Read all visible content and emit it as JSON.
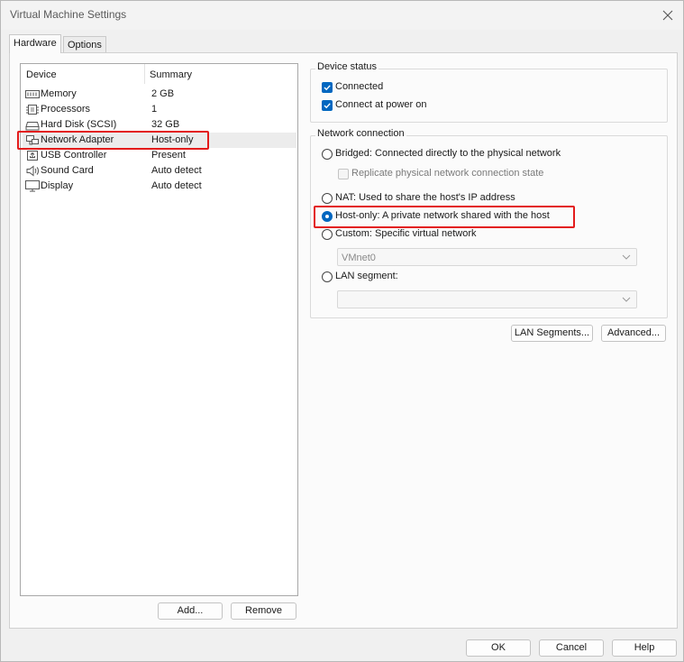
{
  "window": {
    "title": "Virtual Machine Settings"
  },
  "tabs": [
    {
      "label": "Hardware",
      "active": true
    },
    {
      "label": "Options",
      "active": false
    }
  ],
  "device_list": {
    "headers": {
      "device": "Device",
      "summary": "Summary"
    },
    "rows": [
      {
        "name": "Memory",
        "summary": "2 GB",
        "icon": "memory-icon"
      },
      {
        "name": "Processors",
        "summary": "1",
        "icon": "processor-icon"
      },
      {
        "name": "Hard Disk (SCSI)",
        "summary": "32 GB",
        "icon": "hard-disk-icon"
      },
      {
        "name": "Network Adapter",
        "summary": "Host-only",
        "icon": "network-adapter-icon",
        "selected": true
      },
      {
        "name": "USB Controller",
        "summary": "Present",
        "icon": "usb-icon"
      },
      {
        "name": "Sound Card",
        "summary": "Auto detect",
        "icon": "speaker-icon"
      },
      {
        "name": "Display",
        "summary": "Auto detect",
        "icon": "monitor-icon"
      }
    ],
    "add_label": "Add...",
    "remove_label": "Remove"
  },
  "device_status": {
    "title": "Device status",
    "connected": {
      "label": "Connected",
      "checked": true
    },
    "connect_at_power_on": {
      "label": "Connect at power on",
      "checked": true
    }
  },
  "network_connection": {
    "title": "Network connection",
    "bridged": {
      "label": "Bridged: Connected directly to the physical network",
      "checked": false
    },
    "replicate": {
      "label": "Replicate physical network connection state",
      "checked": false,
      "disabled": true
    },
    "nat": {
      "label": "NAT: Used to share the host's IP address",
      "checked": false
    },
    "host_only": {
      "label": "Host-only: A private network shared with the host",
      "checked": true
    },
    "custom": {
      "label": "Custom: Specific virtual network",
      "checked": false
    },
    "custom_value": "VMnet0",
    "lan_segment": {
      "label": "LAN segment:",
      "checked": false
    },
    "lan_segment_value": ""
  },
  "buttons": {
    "lan_segments": "LAN Segments...",
    "advanced": "Advanced...",
    "ok": "OK",
    "cancel": "Cancel",
    "help": "Help"
  },
  "colors": {
    "accent": "#0067c0",
    "highlight": "#e31b1b"
  }
}
